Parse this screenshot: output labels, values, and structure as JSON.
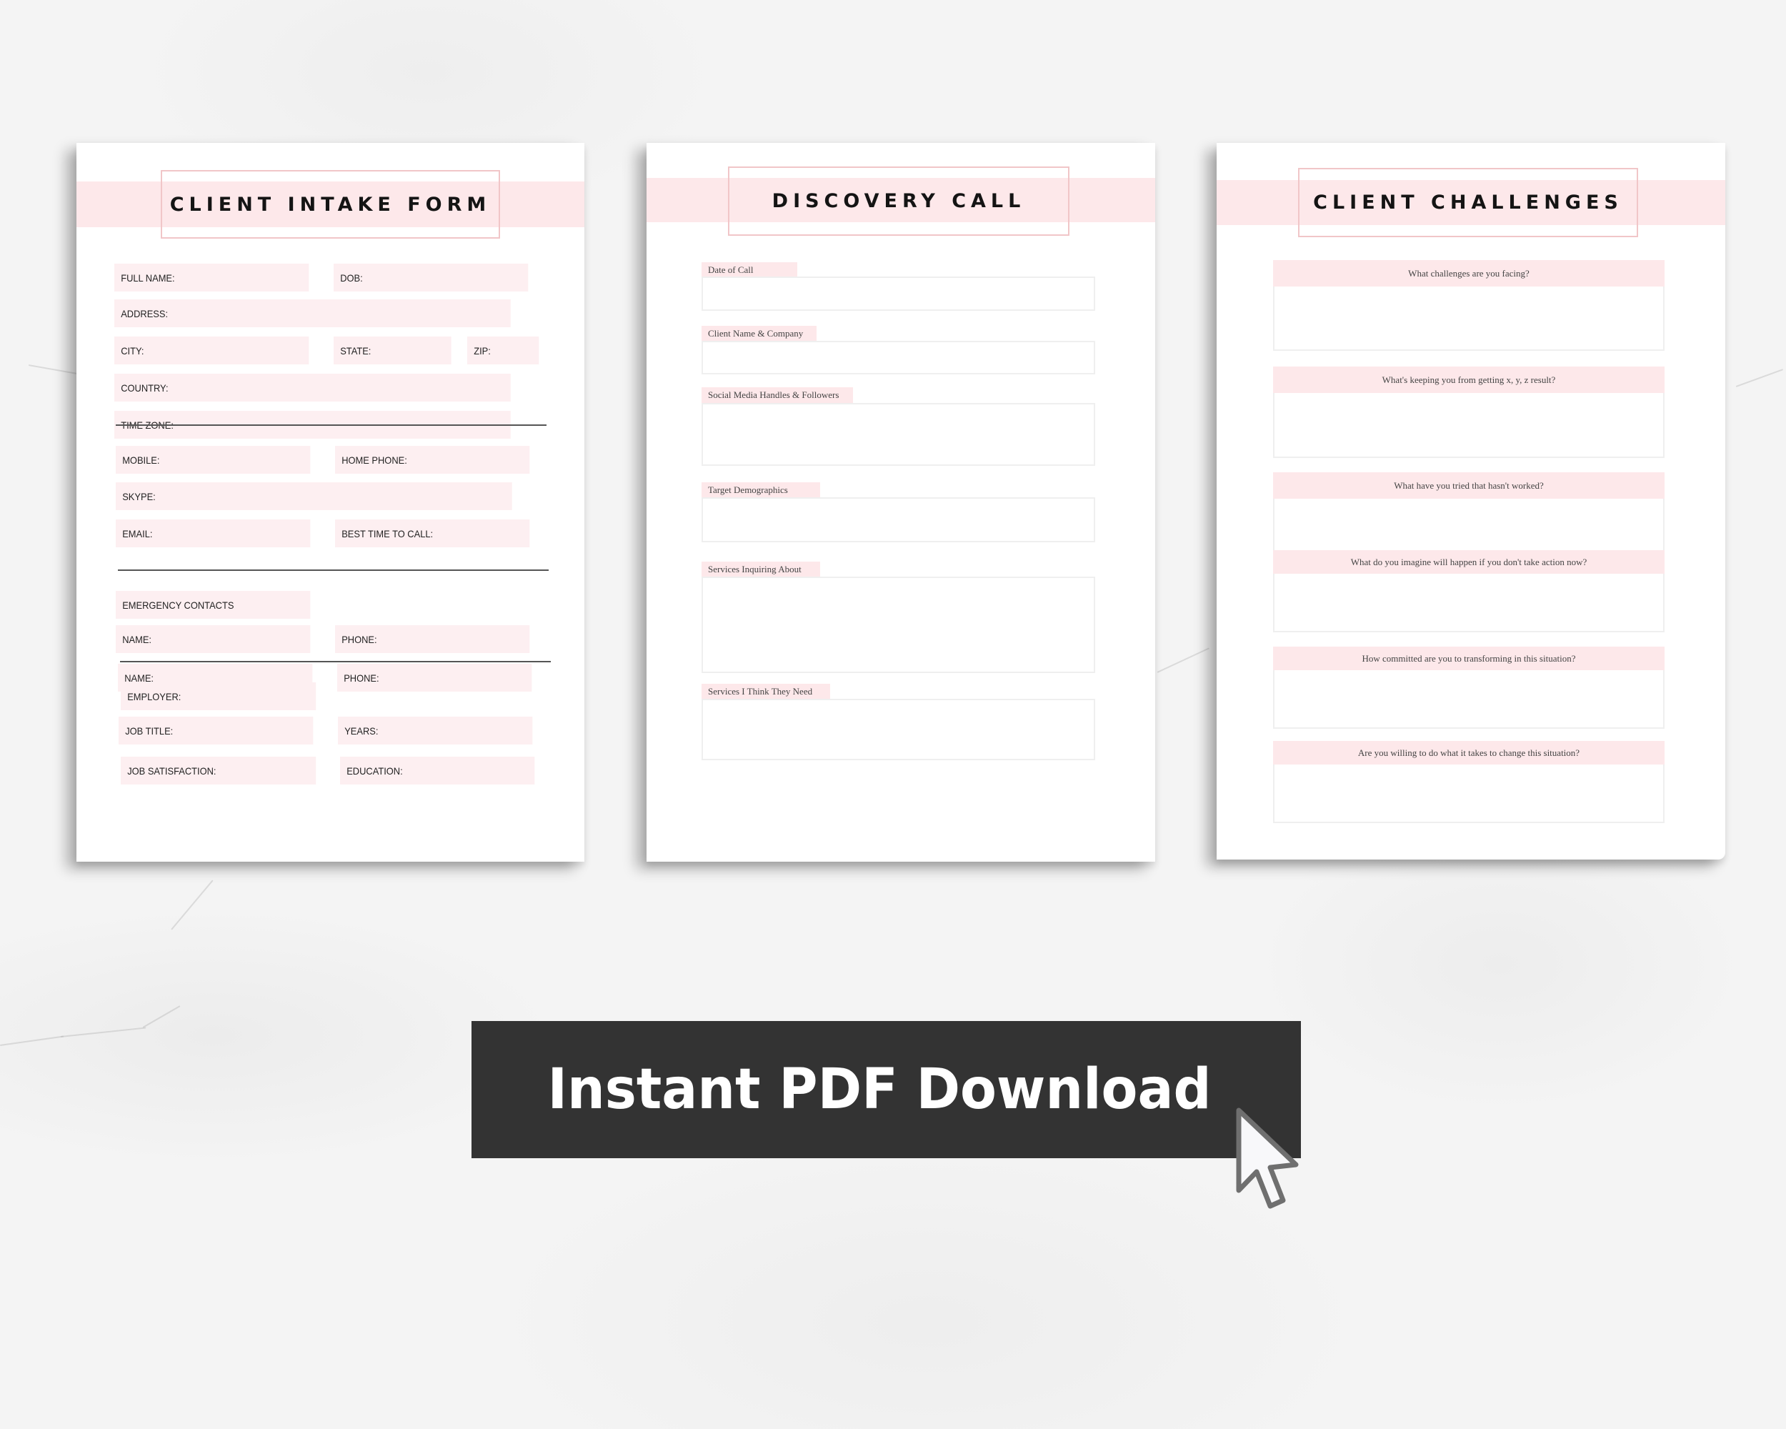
{
  "pages": {
    "intake": {
      "title": "CLIENT INTAKE FORM",
      "fields": {
        "full_name": "FULL NAME:",
        "dob": "DOB:",
        "address": "ADDRESS:",
        "city": "CITY:",
        "state": "STATE:",
        "zip": "ZIP:",
        "country": "COUNTRY:",
        "time_zone": "TIME ZONE:",
        "mobile": "MOBILE:",
        "home_phone": "HOME PHONE:",
        "skype": "SKYPE:",
        "email": "EMAIL:",
        "best_time": "BEST TIME TO CALL:",
        "emergency": "EMERGENCY CONTACTS",
        "name_1": "NAME:",
        "phone_1": "PHONE:",
        "name_2": "NAME:",
        "phone_2": "PHONE:",
        "employer": "EMPLOYER:",
        "job_title": "JOB TITLE:",
        "years": "YEARS:",
        "job_satisfaction": "JOB SATISFACTION:",
        "education": "EDUCATION:"
      }
    },
    "discovery": {
      "title": "DISCOVERY CALL",
      "sections": [
        {
          "label": "Date of Call"
        },
        {
          "label": "Client Name & Company"
        },
        {
          "label": "Social Media Handles & Followers"
        },
        {
          "label": "Target Demographics"
        },
        {
          "label": "Services Inquiring About"
        },
        {
          "label": "Services I Think They Need"
        }
      ]
    },
    "challenges": {
      "title": "CLIENT CHALLENGES",
      "questions": [
        {
          "label": "What challenges are you facing?"
        },
        {
          "label": "What's keeping you from getting x, y, z result?"
        },
        {
          "label": "What have you tried that hasn't worked?"
        },
        {
          "label": "What do you imagine will happen if you don't take action now?"
        },
        {
          "label": "How committed are you to transforming in this situation?"
        },
        {
          "label": "Are you willing to do what it takes to change this situation?"
        }
      ]
    }
  },
  "cta": {
    "label": "Instant PDF Download",
    "icon": "mouse-pointer-icon"
  },
  "colors": {
    "accent_pink": "#fde8ea",
    "title_border": "#f1c6c8",
    "button_bg": "#333333",
    "button_text": "#ffffff"
  }
}
